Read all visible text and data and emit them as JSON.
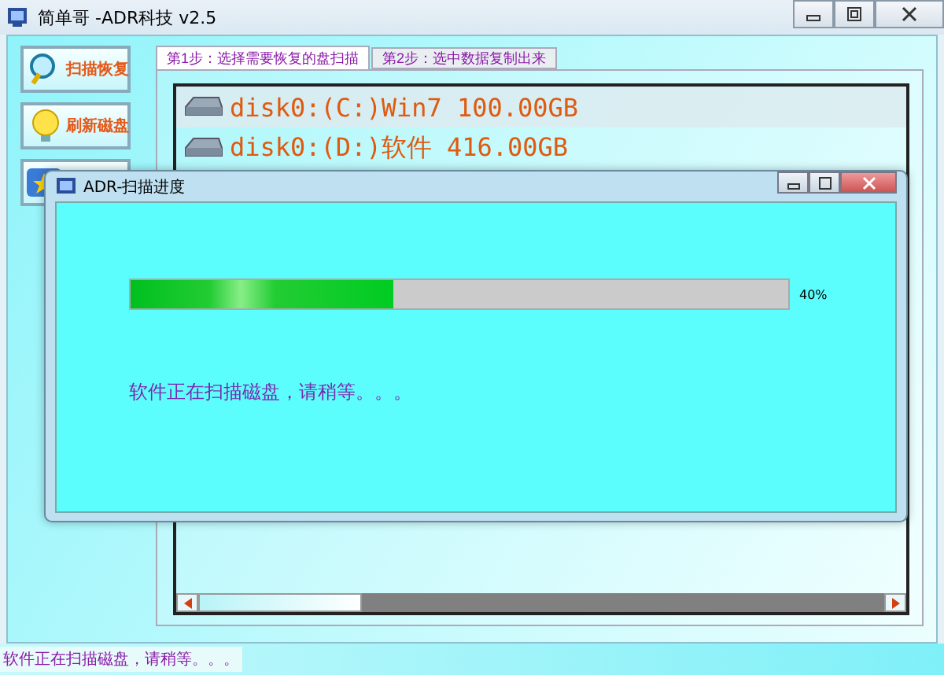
{
  "window": {
    "title": "简单哥  -ADR科技 v2.5"
  },
  "side_buttons": [
    {
      "label": "扫描恢复",
      "kind": "scan"
    },
    {
      "label": "刷新磁盘",
      "kind": "refresh"
    },
    {
      "kind": "star"
    }
  ],
  "tabs": [
    {
      "label": "第1步：选择需要恢复的盘扫描",
      "selected": true
    },
    {
      "label": "第2步：选中数据复制出来",
      "selected": false
    }
  ],
  "drives": [
    {
      "label": "disk0:(C:)Win7 100.00GB",
      "selected": true
    },
    {
      "label": "disk0:(D:)软件 416.00GB",
      "selected": false
    }
  ],
  "dialog": {
    "title": "ADR-扫描进度",
    "progress": {
      "level": 0.4,
      "reading": "40%"
    },
    "message": "软件正在扫描磁盘，请稍等。。。"
  },
  "status_bar": "软件正在扫描磁盘，请稍等。。。"
}
